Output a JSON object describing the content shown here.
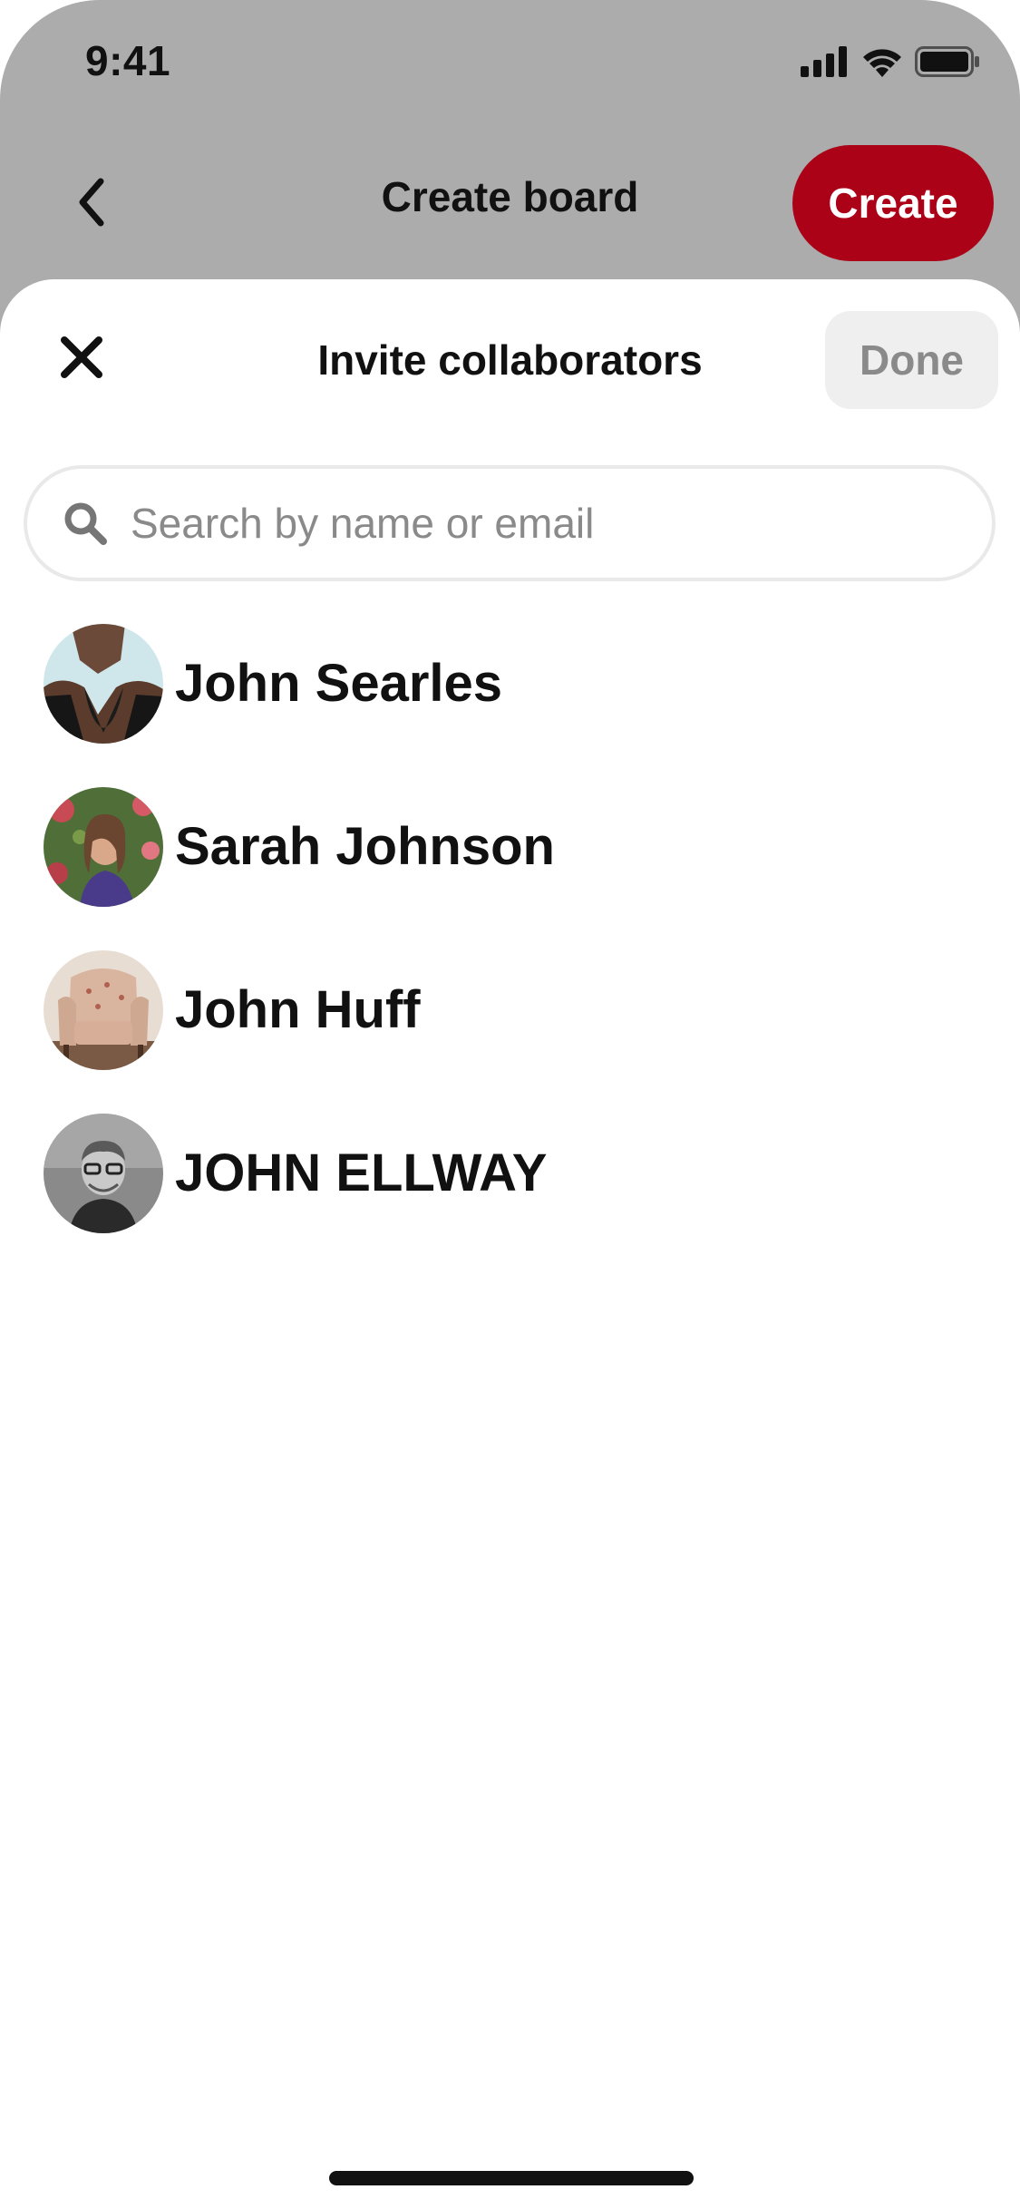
{
  "status_bar": {
    "time": "9:41",
    "icons": [
      "signal-icon",
      "wifi-icon",
      "battery-icon"
    ]
  },
  "nav": {
    "title": "Create board",
    "back_icon": "chevron-left-icon",
    "create_label": "Create"
  },
  "sheet": {
    "title": "Invite collaborators",
    "close_icon": "close-icon",
    "done_label": "Done",
    "search": {
      "placeholder": "Search by name or email",
      "value": "",
      "icon": "search-icon"
    },
    "results": [
      {
        "name": "John Searles"
      },
      {
        "name": "Sarah Johnson"
      },
      {
        "name": "John Huff"
      },
      {
        "name": "JOHN ELLWAY"
      }
    ]
  },
  "colors": {
    "accent": "#ab0218",
    "backdrop": "#acacac",
    "done_bg": "#efefef",
    "done_text": "#8a8a8a",
    "text": "#111111"
  }
}
